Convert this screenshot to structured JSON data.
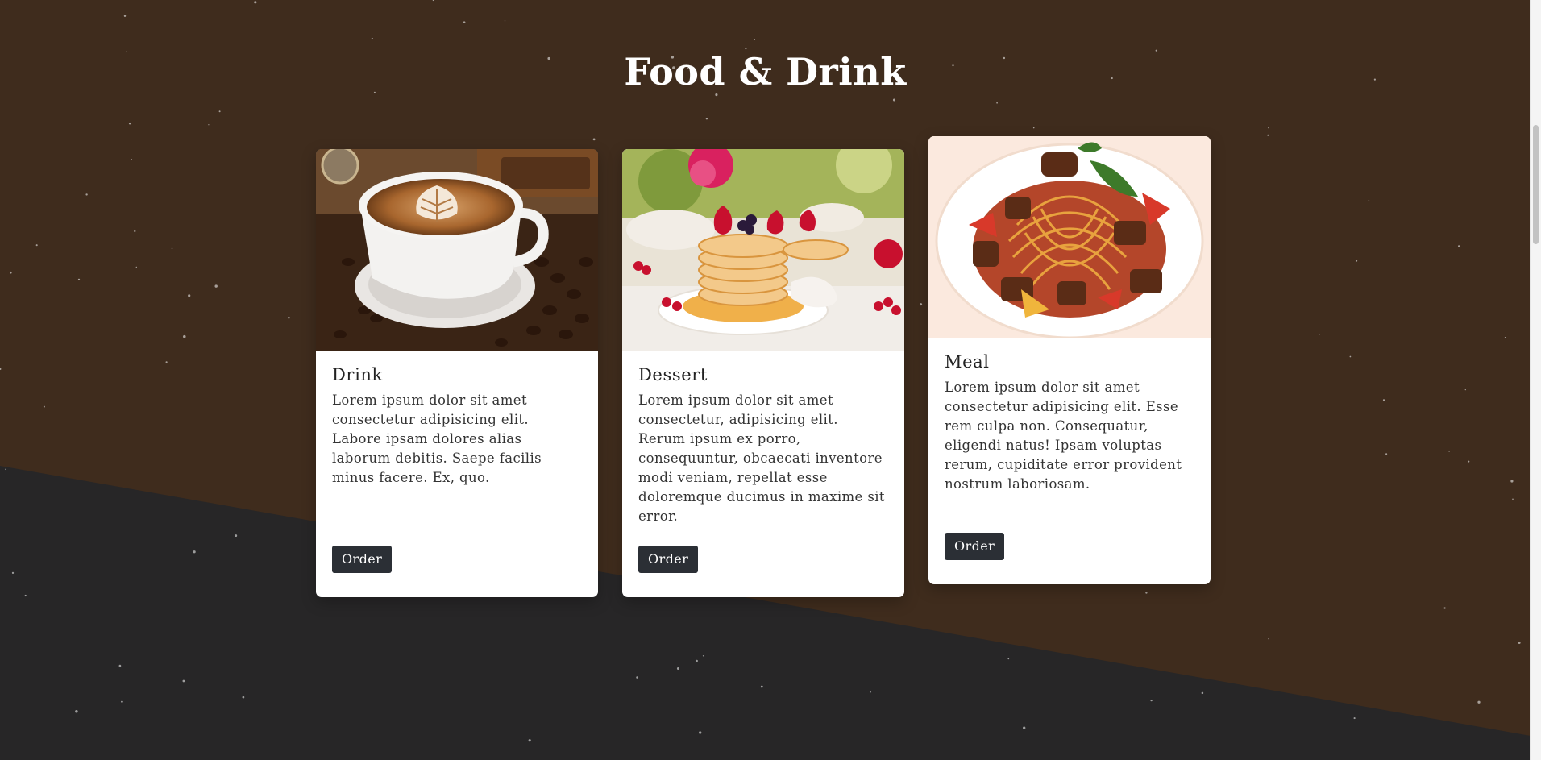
{
  "section": {
    "title": "Food & Drink"
  },
  "colors": {
    "upper_background": "#3f2c1d",
    "lower_background": "#272627",
    "card_background": "#ffffff",
    "button_background": "#2b2f35"
  },
  "cards": [
    {
      "title": "Drink",
      "image": "cappuccino-image",
      "text": "Lorem ipsum dolor sit amet consectetur adipisicing elit. Labore ipsam dolores alias laborum debitis. Saepe facilis minus facere. Ex, quo.",
      "button_label": "Order"
    },
    {
      "title": "Dessert",
      "image": "pancakes-image",
      "text": "Lorem ipsum dolor sit amet consectetur, adipisicing elit. Rerum ipsum ex porro, consequuntur, obcaecati inventore modi veniam, repellat esse doloremque ducimus in maxime sit error.",
      "button_label": "Order"
    },
    {
      "title": "Meal",
      "image": "spaghetti-image",
      "text": "Lorem ipsum dolor sit amet consectetur adipisicing elit. Esse rem culpa non. Consequatur, eligendi natus! Ipsam voluptas rerum, cupiditate error provident nostrum laboriosam.",
      "button_label": "Order"
    }
  ]
}
